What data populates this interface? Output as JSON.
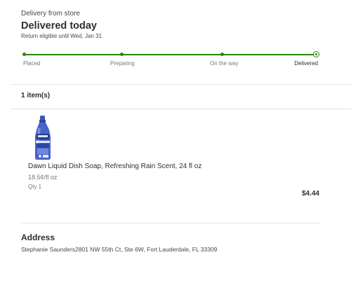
{
  "order": {
    "type": "Delivery from store",
    "status_title": "Delivered today",
    "return_note": "Return eligible until Wed, Jan 31"
  },
  "tracker": {
    "steps": [
      {
        "label": "Placed"
      },
      {
        "label": "Preparing"
      },
      {
        "label": "On the way"
      },
      {
        "label": "Delivered"
      }
    ],
    "current_step": "Delivered",
    "accent_color": "#2a8703"
  },
  "items": {
    "count_label": "1 item(s)",
    "list": [
      {
        "name": "Dawn Liquid Dish Soap, Refreshing Rain Scent, 24 fl oz",
        "unit_price": "18.5¢/fl oz",
        "qty": "Qty 1",
        "price": "$4.44",
        "image_icon": "dish-soap-bottle"
      }
    ]
  },
  "address": {
    "title": "Address",
    "text": "Stephanie Saunders2801 NW 55th Ct, Ste 6W, Fort Lauderdale, FL 33309"
  }
}
